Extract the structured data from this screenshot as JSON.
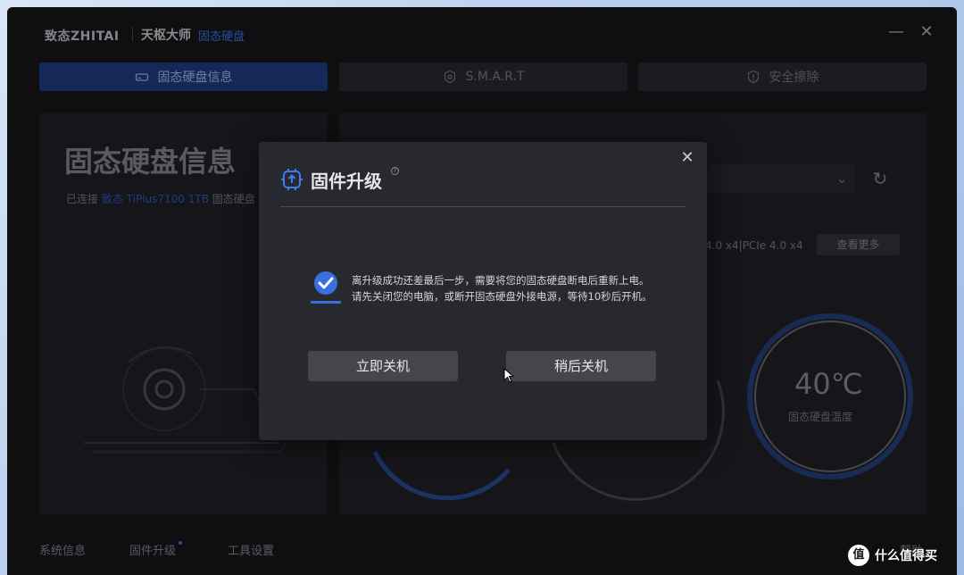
{
  "header": {
    "brand": "致态ZHITAI",
    "product": "天枢大师",
    "product_sub": "固态硬盘"
  },
  "tabs": [
    {
      "label": "固态硬盘信息",
      "icon": "drive-icon",
      "active": true
    },
    {
      "label": "S.M.A.R.T",
      "icon": "smart-icon",
      "active": false
    },
    {
      "label": "安全擦除",
      "icon": "shield-icon",
      "active": false
    }
  ],
  "left_panel": {
    "title": "固态硬盘信息",
    "connected_prefix": "已连接",
    "model": "致态 TiPlus7100 1TB",
    "connected_suffix": "固态硬盘"
  },
  "right_panel": {
    "interface": "4.0 x4|PCIe 4.0 x4",
    "more_button": "查看更多",
    "temperature_value": "40℃",
    "temperature_label": "固态硬盘温度"
  },
  "bottom_nav": {
    "system_info": "系统信息",
    "firmware_upgrade": "固件升级",
    "tool_settings": "工具设置",
    "help": "帮助"
  },
  "modal": {
    "title": "固件升级",
    "message_line1": "离升级成功还差最后一步，需要将您的固态硬盘断电后重新上电。",
    "message_line2": "请先关闭您的电脑，或断开固态硬盘外接电源，等待10秒后开机。",
    "btn_now": "立即关机",
    "btn_later": "稍后关机"
  },
  "watermark": {
    "badge": "值",
    "text": "什么值得买"
  },
  "colors": {
    "accent": "#3a7bf0",
    "active_tab": "#1f3f86",
    "app_bg": "#17181c",
    "modal_bg": "#28292e"
  }
}
